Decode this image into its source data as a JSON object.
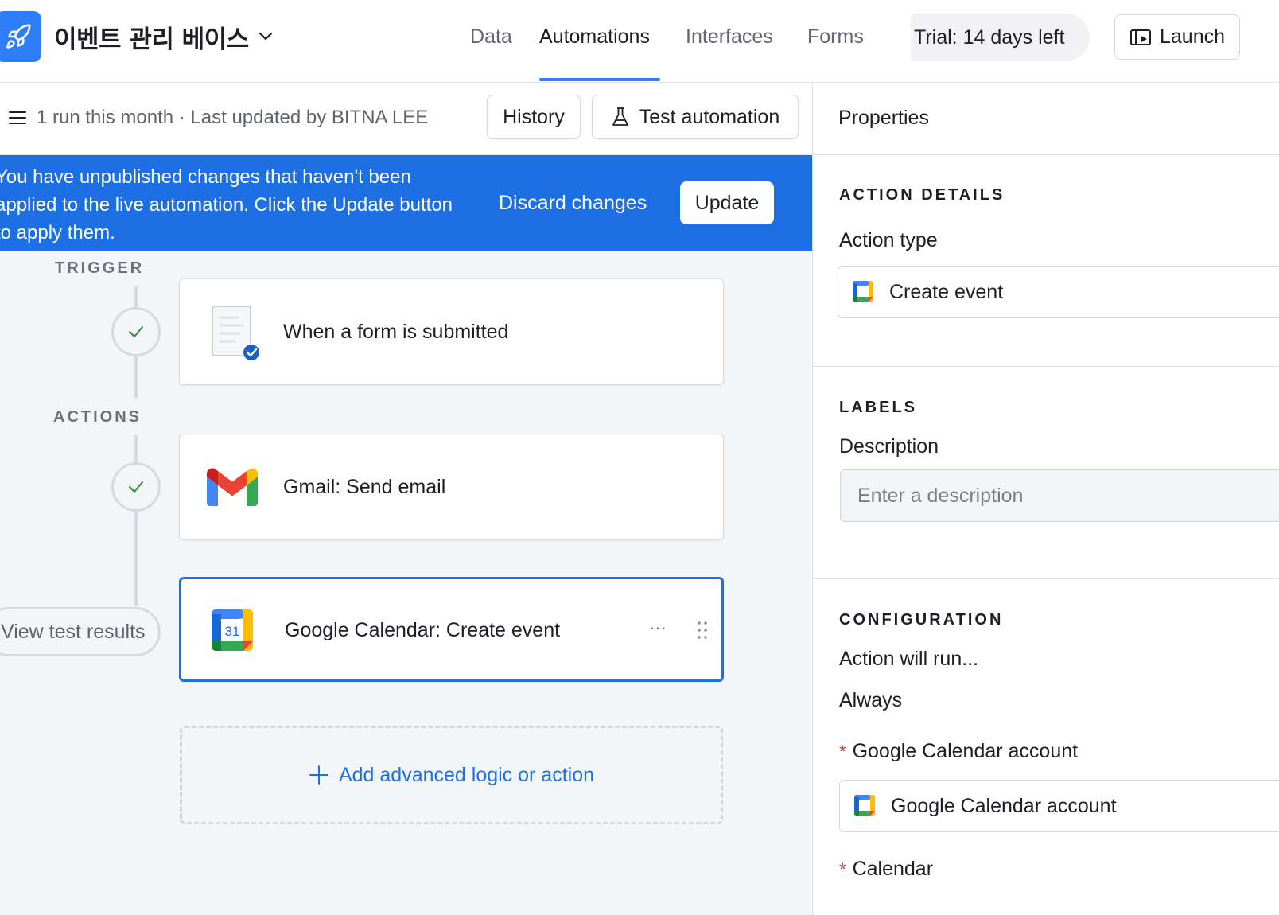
{
  "header": {
    "base_name": "이벤트 관리 베이스",
    "nav_tabs": [
      {
        "label": "Data"
      },
      {
        "label": "Automations"
      },
      {
        "label": "Interfaces"
      },
      {
        "label": "Forms"
      }
    ],
    "active_tab": "Automations",
    "trial_text": "Trial: 14 days left",
    "launch_label": "Launch"
  },
  "toolbar": {
    "run_info": "1 run this month · Last updated by BITNA LEE",
    "history_label": "History",
    "test_label": "Test automation"
  },
  "banner": {
    "message": "You have unpublished changes that haven't been applied to the live automation. Click the Update button to apply them.",
    "discard_label": "Discard changes",
    "update_label": "Update"
  },
  "workflow": {
    "trigger_label": "TRIGGER",
    "actions_label": "ACTIONS",
    "trigger_card": {
      "title": "When a form is submitted",
      "icon": "form-icon"
    },
    "action_cards": [
      {
        "title": "Gmail: Send email",
        "icon": "gmail-icon"
      },
      {
        "title": "Google Calendar: Create event",
        "icon": "google-calendar-icon",
        "calendar_day": "31"
      }
    ],
    "more_label": "···",
    "test_results_label": "View test results",
    "add_label": "Add advanced logic or action"
  },
  "properties": {
    "title": "Properties",
    "action_details": {
      "section": "ACTION DETAILS",
      "action_type_label": "Action type",
      "action_type_value": "Create event"
    },
    "labels": {
      "section": "LABELS",
      "description_label": "Description",
      "description_placeholder": "Enter a description",
      "description_value": ""
    },
    "configuration": {
      "section": "CONFIGURATION",
      "run_label": "Action will run...",
      "run_value": "Always",
      "required_mark": "*",
      "account_label": "Google Calendar account",
      "account_value": "Google Calendar account",
      "calendar_label": "Calendar"
    }
  },
  "colors": {
    "accent": "#2d7ff9",
    "banner": "#1d70e3",
    "required": "#d63030"
  }
}
